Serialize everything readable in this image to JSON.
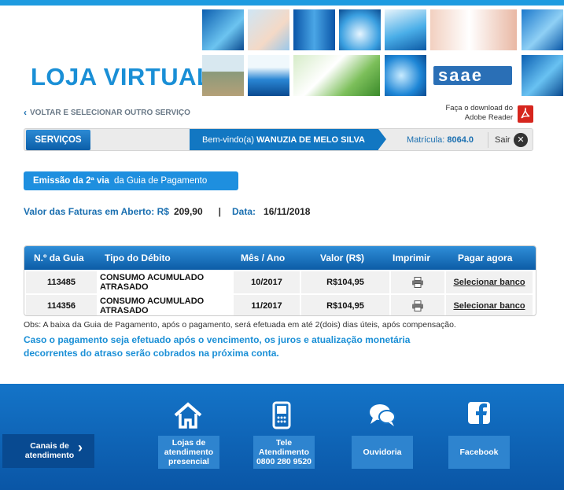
{
  "brand": {
    "title": "LOJA VIRTUAL"
  },
  "nav": {
    "back_label": "VOLTAR E SELECIONAR OUTRO SERVIÇO",
    "adobe_text_1": "Faça o download do",
    "adobe_text_2": "Adobe Reader",
    "servicos_label": "SERVIÇOS",
    "welcome_prefix": "Bem-vindo(a)",
    "welcome_name": "WANUZIA DE MELO SILVA",
    "matricula_label": "Matrícula:",
    "matricula_value": "8064.0",
    "sair_label": "Sair"
  },
  "emissao": {
    "bold": "Emissão da 2ª via",
    "rest": "da Guia de Pagamento"
  },
  "summary": {
    "valor_label": "Valor das Faturas em Aberto: R$",
    "valor_value": "209,90",
    "separator": "|",
    "data_label": "Data:",
    "data_value": "16/11/2018"
  },
  "table": {
    "headers": [
      "N.º da Guia",
      "Tipo do Débito",
      "Mês / Ano",
      "Valor (R$)",
      "Imprimir",
      "Pagar agora"
    ],
    "rows": [
      {
        "guia": "113485",
        "tipo": "CONSUMO ACUMULADO ATRASADO",
        "mes": "10/2017",
        "valor": "R$104,95",
        "pagar": "Selecionar banco"
      },
      {
        "guia": "114356",
        "tipo": "CONSUMO ACUMULADO ATRASADO",
        "mes": "11/2017",
        "valor": "R$104,95",
        "pagar": "Selecionar banco"
      }
    ]
  },
  "obs": "Obs: A baixa da Guia de Pagamento, após o pagamento, será efetuada em até 2(dois) dias úteis, após compensação.",
  "warning": "Caso o pagamento seja efetuado após o vencimento, os juros e atualização monetária decorrentes do atraso serão cobrados na próxima conta.",
  "footer": {
    "canais": "Canais de atendimento",
    "lojas": [
      "Lojas de",
      "atendimento",
      "presencial"
    ],
    "tele": [
      "Tele",
      "Atendimento",
      "0800 280 9520"
    ],
    "ouvidoria": "Ouvidoria",
    "facebook": "Facebook"
  },
  "colors": {
    "primary": "#1a8fd6",
    "navy": "#0b5ea8",
    "footer": "#1474c8"
  }
}
